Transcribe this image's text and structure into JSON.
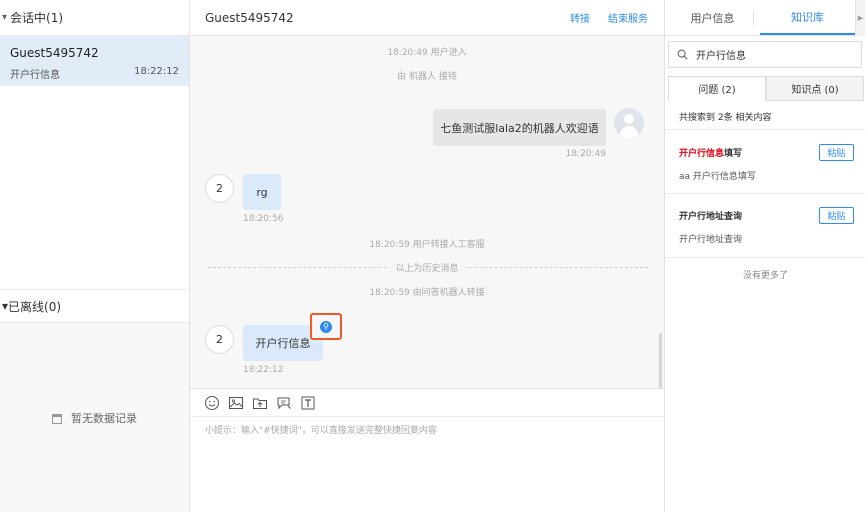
{
  "left": {
    "active_header": "会话中(1)",
    "session": {
      "name": "Guest5495742",
      "last_message": "开户行信息",
      "time": "18:22:12"
    },
    "offline_header": "已离线(0)",
    "empty_text": "暂无数据记录"
  },
  "chat": {
    "guest_name": "Guest5495742",
    "transfer_label": "转接",
    "end_label": "结束服务",
    "messages": {
      "sys_enter": "18:20:49 用户进入",
      "sys_robot": "由 机器人 接待",
      "robot_welcome": "七鱼测试服lala2的机器人欢迎语",
      "robot_time": "18:20:49",
      "user_avatar_num": "2",
      "user_msg1": "rg",
      "user_msg1_time": "18:20:56",
      "sys_transfer": "18:20:59 用户转接人工客服",
      "history_divider": "以上为历史消息",
      "sys_from_robot": "18:20:59 由问答机器人转接",
      "user_msg2": "开户行信息",
      "user_msg2_time": "18:22:12"
    },
    "hint": "小提示：输入\"#快捷词\"，可以直接发送完整快捷回复内容"
  },
  "right": {
    "tabs": [
      "用户信息",
      "知识库"
    ],
    "search_value": "开户行信息",
    "subtabs": [
      "问题 (2)",
      "知识点 (0)"
    ],
    "result_count": "共搜索到 2条 相关内容",
    "items": [
      {
        "title_hl": "开户行信息",
        "title_rest": "填写",
        "body": "aa 开户行信息填写",
        "paste": "粘贴"
      },
      {
        "title_hl": "",
        "title_rest": "开户行地址查询",
        "body": "开户行地址查询",
        "paste": "粘贴"
      }
    ],
    "no_more": "没有更多了"
  },
  "colors": {
    "accent": "#2d8cf0",
    "highlight": "#e60012",
    "focus_box": "#f05a24",
    "session_bg": "#e1ecf8",
    "user_bubble": "#dbeafa"
  }
}
